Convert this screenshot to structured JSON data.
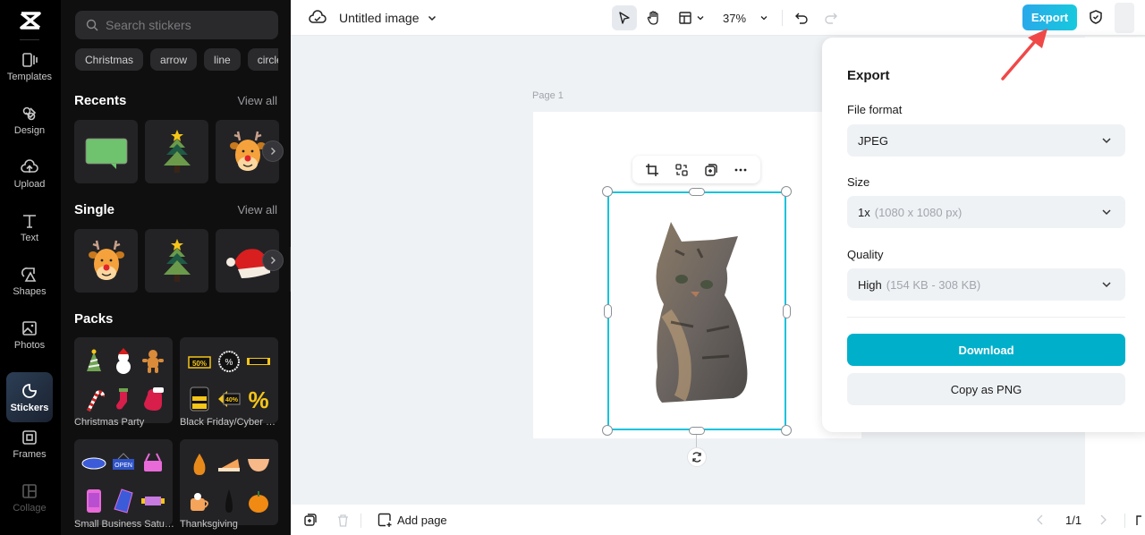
{
  "app": {
    "logo": "capcut-logo-icon"
  },
  "rail": {
    "items": [
      {
        "label": "Templates",
        "icon": "templates-icon"
      },
      {
        "label": "Design",
        "icon": "design-icon"
      },
      {
        "label": "Upload",
        "icon": "upload-cloud-icon"
      },
      {
        "label": "Text",
        "icon": "text-icon"
      },
      {
        "label": "Shapes",
        "icon": "shapes-icon"
      },
      {
        "label": "Photos",
        "icon": "photos-icon"
      },
      {
        "label": "Stickers",
        "icon": "stickers-icon",
        "active": true
      },
      {
        "label": "Frames",
        "icon": "frames-icon"
      },
      {
        "label": "Collage",
        "icon": "collage-icon"
      }
    ]
  },
  "stickers": {
    "search_placeholder": "Search stickers",
    "chips": [
      "Christmas",
      "arrow",
      "line",
      "circle"
    ],
    "recents": {
      "title": "Recents",
      "view_all": "View all",
      "items": [
        "green speech bubble",
        "christmas tree",
        "reindeer"
      ]
    },
    "single": {
      "title": "Single",
      "view_all": "View all",
      "items": [
        "reindeer",
        "christmas tree",
        "santa hat"
      ]
    },
    "packs": {
      "title": "Packs",
      "items": [
        {
          "label": "Christmas Party"
        },
        {
          "label": "Black Friday/Cyber M..."
        },
        {
          "label": "Small Business Saturd..."
        },
        {
          "label": "Thanksgiving"
        }
      ]
    }
  },
  "topbar": {
    "doc_title": "Untitled image",
    "zoom": "37%",
    "export_label": "Export"
  },
  "canvas": {
    "page_label": "Page 1"
  },
  "export_panel": {
    "title": "Export",
    "file_format": {
      "label": "File format",
      "value": "JPEG",
      "detail": ""
    },
    "size": {
      "label": "Size",
      "value": "1x",
      "detail": "(1080 x 1080 px)"
    },
    "quality": {
      "label": "Quality",
      "value": "High",
      "detail": "(154 KB - 308 KB)"
    },
    "download_label": "Download",
    "copy_label": "Copy as PNG"
  },
  "bottombar": {
    "add_page_label": "Add page",
    "page_indicator": "1/1"
  },
  "colors": {
    "accent": "#15c3dd",
    "download": "#00b0cb",
    "annotation_arrow": "#f04848"
  }
}
